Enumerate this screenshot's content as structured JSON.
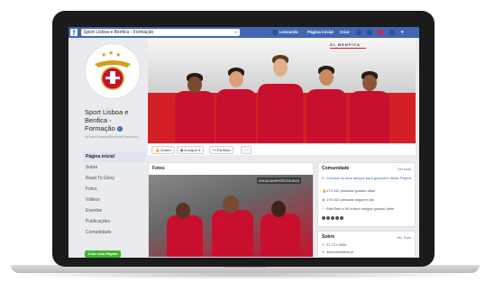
{
  "topbar": {
    "logo": "f",
    "search": "Sport Lisboa e Benfica - Formação",
    "user": "Leonardo",
    "home": "Página inicial",
    "create": "Criar"
  },
  "page": {
    "name_line1": "Sport Lisboa e",
    "name_line2": "Benfica -",
    "name_line3": "Formação",
    "handle": "@SportLisboaeBenficaFormacao",
    "menu": [
      "Página inicial",
      "Sobre",
      "Road To Glory",
      "Fotos",
      "Vídeos",
      "Eventos",
      "Publicações",
      "Comunidade"
    ],
    "create_page": "Criar uma Página"
  },
  "cover": {
    "brand": "SL BENFICA"
  },
  "actions": {
    "like": "Gostei",
    "follow": "A seguir",
    "share": "Partilhar",
    "more": "···"
  },
  "photos": {
    "title": "Fotos",
    "hashtag": "#SLBCAMPEÕESSUB23"
  },
  "community": {
    "title": "Comunidade",
    "see_all": "Ver tudo",
    "invite": "Convida os teus amigos para gostarem desta Página",
    "likes": "173 442 pessoas gostam disto",
    "follows": "175 343 pessoas seguem isto",
    "friends": "Rita Reis e 95 outros amigos gostam disto"
  },
  "about": {
    "title": "Sobre",
    "see_all": "Ver Tudo",
    "phone": "21 721 9500",
    "site": "www.slbenfica.pt"
  },
  "colors": {
    "facebook_blue": "#4267b2",
    "benfica_red": "#c8102e",
    "green": "#42b72a"
  }
}
